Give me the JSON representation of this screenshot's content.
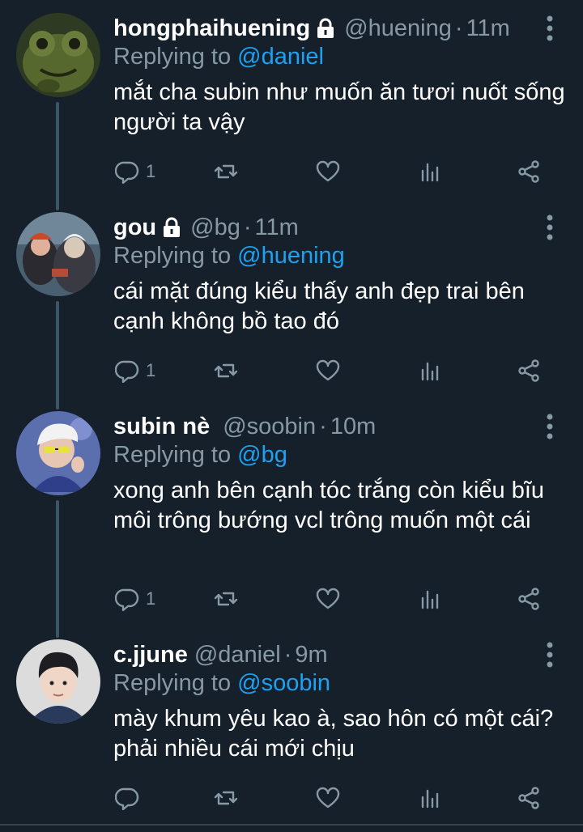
{
  "tweets": [
    {
      "name": "hongphaihuening",
      "locked": true,
      "handle": "@huening",
      "time": "11m",
      "replying_prefix": "Replying to ",
      "replying_to": "@daniel",
      "text": "mắt cha subin như muốn ăn tươi nuốt sống người ta vậy",
      "reply_count": "1",
      "avatar": "green-frog-avatar"
    },
    {
      "name": "gou",
      "locked": true,
      "handle": "@bg",
      "time": "11m",
      "replying_prefix": "Replying to ",
      "replying_to": "@huening",
      "text": "cái mặt đúng kiểu thấy anh đẹp trai bên cạnh không bồ tao đó",
      "reply_count": "1",
      "avatar": "cartoon-scene-avatar"
    },
    {
      "name": "subin nè",
      "locked": false,
      "handle": "@soobin",
      "time": "10m",
      "replying_prefix": "Replying to ",
      "replying_to": "@bg",
      "text": "xong anh bên cạnh tóc trắng còn kiểu bĩu môi trông bướng vcl trông muốn một cái",
      "reply_count": "1",
      "avatar": "person-sunglasses-avatar"
    },
    {
      "name": "c.jjune",
      "locked": false,
      "handle": "@daniel",
      "time": "9m",
      "replying_prefix": "Replying to ",
      "replying_to": "@soobin",
      "text": "mày khum yêu kao à, sao hôn có một cái? phải nhiều cái mới chịu",
      "reply_count": "",
      "avatar": "person-portrait-avatar"
    }
  ],
  "separator": "·",
  "colors": {
    "background": "#15202b",
    "secondary_text": "#8899a6",
    "mention": "#1da1f2",
    "thread_line": "#3d5466"
  },
  "icons": [
    "lock-icon",
    "more-vertical-icon",
    "reply-icon",
    "retweet-icon",
    "like-icon",
    "analytics-icon",
    "share-icon"
  ]
}
